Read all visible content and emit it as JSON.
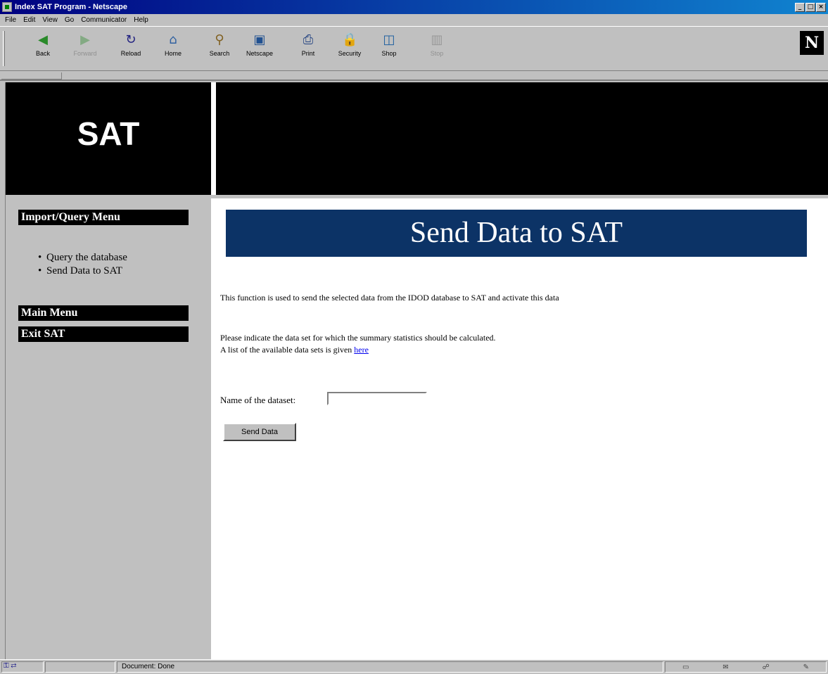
{
  "window": {
    "title": "Index SAT Program - Netscape",
    "controls": [
      "_",
      "□",
      "×"
    ]
  },
  "menubar": {
    "items": [
      "File",
      "Edit",
      "View",
      "Go",
      "Communicator",
      "Help"
    ]
  },
  "toolbar": {
    "buttons": [
      {
        "label": "Back",
        "icon": "back-arrow-icon",
        "glyph": "◀"
      },
      {
        "label": "Forward",
        "icon": "forward-arrow-icon",
        "glyph": "▶"
      },
      {
        "label": "Reload",
        "icon": "reload-icon",
        "glyph": "↻"
      },
      {
        "label": "Home",
        "icon": "home-icon",
        "glyph": "⌂"
      },
      {
        "label": "Search",
        "icon": "search-icon",
        "glyph": "⚲"
      },
      {
        "label": "Netscape",
        "icon": "netscape-icon",
        "glyph": "▣"
      },
      {
        "label": "Print",
        "icon": "print-icon",
        "glyph": "⎙"
      },
      {
        "label": "Security",
        "icon": "security-lock-icon",
        "glyph": "🔒"
      },
      {
        "label": "Shop",
        "icon": "shop-icon",
        "glyph": "◫"
      },
      {
        "label": "Stop",
        "icon": "stop-icon",
        "glyph": "▥"
      }
    ],
    "throbber": "N"
  },
  "frames": {
    "logo": "SAT",
    "menu": {
      "section_title": "Import/Query Menu",
      "items": [
        "Query the database",
        "Send Data to SAT"
      ],
      "main_menu": "Main Menu",
      "exit": "Exit SAT"
    },
    "content": {
      "heading": "Send Data to SAT",
      "intro": "This function is used to send the selected data from the IDOD database to SAT and activate this data",
      "instruction_1": "Please indicate the data set for which the summary statistics should be calculated.",
      "instruction_2_prefix": "A list of the available data sets is given ",
      "instruction_2_link": "here",
      "dataset_label": "Name of the dataset:",
      "dataset_value": "",
      "send_button": "Send Data"
    }
  },
  "statusbar": {
    "text": "Document: Done"
  }
}
